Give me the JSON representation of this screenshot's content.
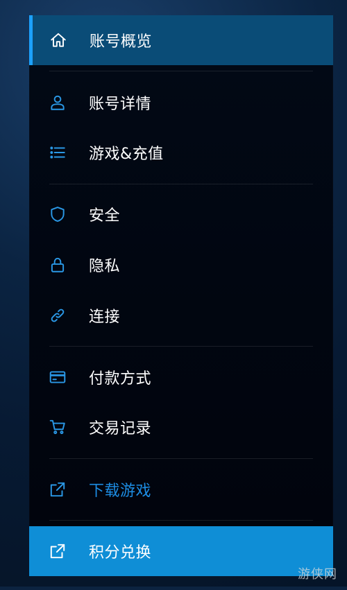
{
  "menu": {
    "items": [
      {
        "label": "账号概览",
        "icon": "home-icon"
      },
      {
        "label": "账号详情",
        "icon": "user-icon"
      },
      {
        "label": "游戏&充值",
        "icon": "list-icon"
      },
      {
        "label": "安全",
        "icon": "shield-icon"
      },
      {
        "label": "隐私",
        "icon": "lock-icon"
      },
      {
        "label": "连接",
        "icon": "link-icon"
      },
      {
        "label": "付款方式",
        "icon": "credit-card-icon"
      },
      {
        "label": "交易记录",
        "icon": "cart-icon"
      },
      {
        "label": "下载游戏",
        "icon": "external-link-icon"
      },
      {
        "label": "积分兑换",
        "icon": "external-link-icon"
      }
    ]
  },
  "colors": {
    "accent": "#1ca1ff",
    "active_bg": "#0a4c77",
    "promo_bg": "#0f8ed6",
    "icon_blue": "#2a98e6",
    "link_text": "#1d8de4"
  },
  "watermark": {
    "text": "游侠网"
  }
}
